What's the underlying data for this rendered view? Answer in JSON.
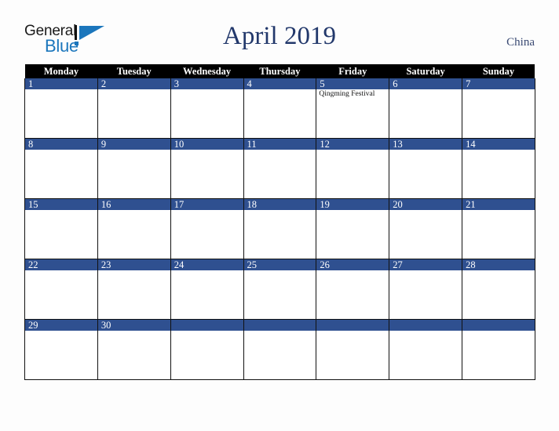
{
  "brand": {
    "name_part1": "General",
    "name_part2": "Blue",
    "mark_icon": "blue-triangle-logo-icon",
    "color_dark": "#1a1a1a",
    "color_blue": "#1b76bc"
  },
  "header": {
    "title": "April 2019",
    "country": "China",
    "title_color": "#22386b"
  },
  "calendar": {
    "month": "April",
    "year": "2019",
    "accent_color": "#2f5090",
    "header_bg": "#000000",
    "weekday_headers": [
      "Monday",
      "Tuesday",
      "Wednesday",
      "Thursday",
      "Friday",
      "Saturday",
      "Sunday"
    ],
    "weeks": [
      [
        {
          "day": "1",
          "events": []
        },
        {
          "day": "2",
          "events": []
        },
        {
          "day": "3",
          "events": []
        },
        {
          "day": "4",
          "events": []
        },
        {
          "day": "5",
          "events": [
            "Qingming Festival"
          ]
        },
        {
          "day": "6",
          "events": []
        },
        {
          "day": "7",
          "events": []
        }
      ],
      [
        {
          "day": "8",
          "events": []
        },
        {
          "day": "9",
          "events": []
        },
        {
          "day": "10",
          "events": []
        },
        {
          "day": "11",
          "events": []
        },
        {
          "day": "12",
          "events": []
        },
        {
          "day": "13",
          "events": []
        },
        {
          "day": "14",
          "events": []
        }
      ],
      [
        {
          "day": "15",
          "events": []
        },
        {
          "day": "16",
          "events": []
        },
        {
          "day": "17",
          "events": []
        },
        {
          "day": "18",
          "events": []
        },
        {
          "day": "19",
          "events": []
        },
        {
          "day": "20",
          "events": []
        },
        {
          "day": "21",
          "events": []
        }
      ],
      [
        {
          "day": "22",
          "events": []
        },
        {
          "day": "23",
          "events": []
        },
        {
          "day": "24",
          "events": []
        },
        {
          "day": "25",
          "events": []
        },
        {
          "day": "26",
          "events": []
        },
        {
          "day": "27",
          "events": []
        },
        {
          "day": "28",
          "events": []
        }
      ],
      [
        {
          "day": "29",
          "events": []
        },
        {
          "day": "30",
          "events": []
        },
        {
          "day": "",
          "events": []
        },
        {
          "day": "",
          "events": []
        },
        {
          "day": "",
          "events": []
        },
        {
          "day": "",
          "events": []
        },
        {
          "day": "",
          "events": []
        }
      ]
    ]
  }
}
